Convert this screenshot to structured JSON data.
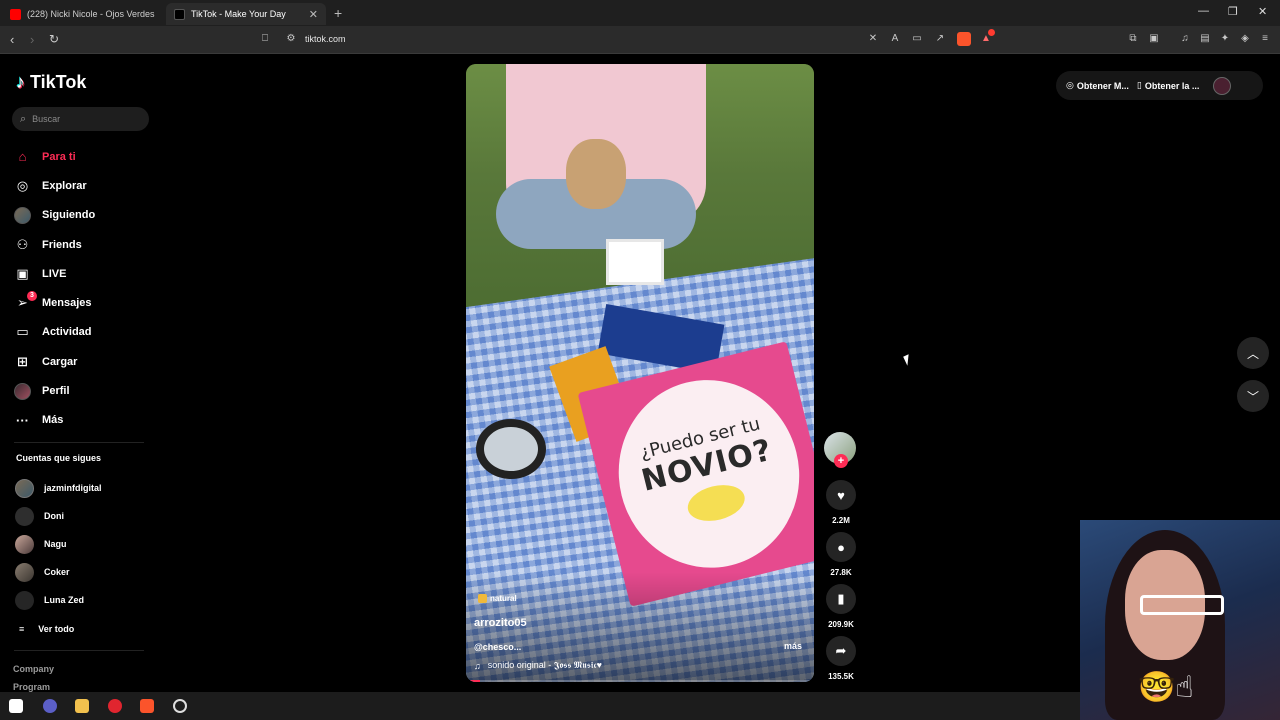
{
  "browser": {
    "tabs": [
      {
        "title": "(228) Nicki Nicole - Ojos Verdes (Offi",
        "favicon_color": "#ff0000",
        "active": false
      },
      {
        "title": "TikTok - Make Your Day",
        "favicon_color": "#000000",
        "active": true
      }
    ],
    "new_tab_icon": "plus-icon",
    "url": "tiktok.com",
    "window_controls": {
      "minimize": "—",
      "restore": "❐",
      "close": "✕"
    }
  },
  "tiktok": {
    "logo_text": "TikTok",
    "search_placeholder": "Buscar",
    "nav": [
      {
        "label": "Para ti",
        "icon": "home-icon",
        "active": true
      },
      {
        "label": "Explorar",
        "icon": "compass-icon"
      },
      {
        "label": "Siguiendo",
        "icon": "avatar"
      },
      {
        "label": "Friends",
        "icon": "friends-icon"
      },
      {
        "label": "LIVE",
        "icon": "live-icon"
      },
      {
        "label": "Mensajes",
        "icon": "message-icon",
        "badge": "3"
      },
      {
        "label": "Actividad",
        "icon": "activity-icon"
      },
      {
        "label": "Cargar",
        "icon": "upload-icon"
      },
      {
        "label": "Perfil",
        "icon": "profile-avatar"
      },
      {
        "label": "Más",
        "icon": "more-icon"
      }
    ],
    "following_title": "Cuentas que sigues",
    "following": [
      {
        "name": "jazminfdigital"
      },
      {
        "name": "Doni"
      },
      {
        "name": "Nagu"
      },
      {
        "name": "Coker"
      },
      {
        "name": "Luna Zed"
      }
    ],
    "see_all": "Ver todo",
    "footer": [
      "Company",
      "Program"
    ]
  },
  "video": {
    "card_line1": "¿Puedo ser tu",
    "card_line2": "NOVIO?",
    "tag": "natural",
    "author": "arrozito05",
    "description": "@chesco...",
    "more": "más",
    "music": "sonido original - 𝕵𝖔𝖘𝖘 𝕸𝖚𝖘𝖎𝖈♥",
    "progress": 0.04,
    "actions": {
      "likes": "2.2M",
      "comments": "27.8K",
      "saves": "209.9K",
      "shares": "135.5K"
    }
  },
  "top_actions": {
    "item1": "Obtener M...",
    "item2": "Obtener la ..."
  }
}
